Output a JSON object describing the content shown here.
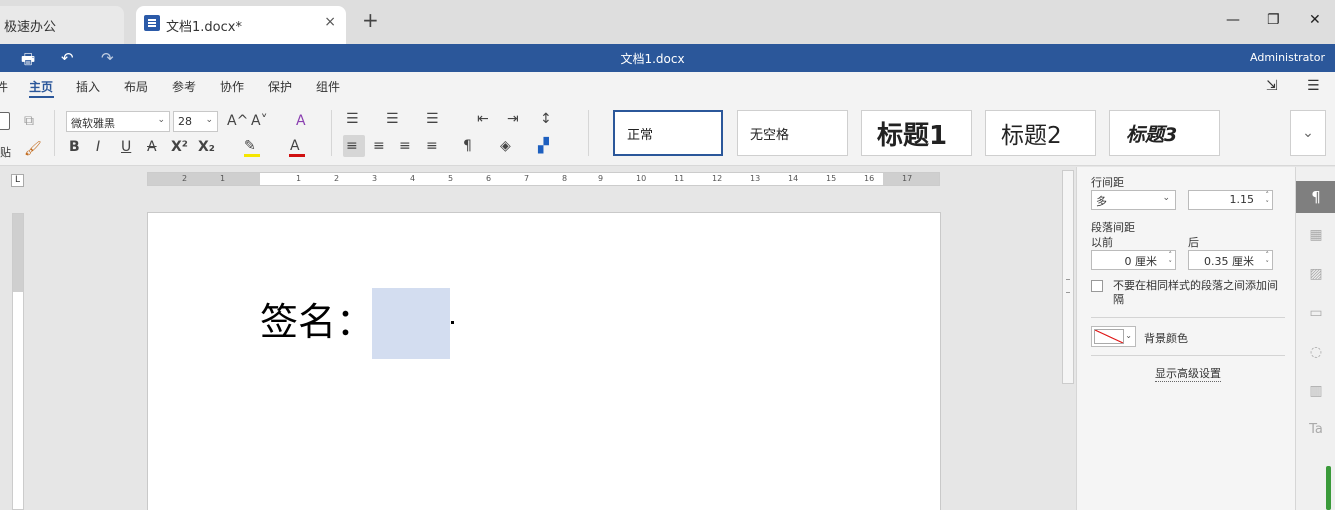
{
  "browser": {
    "inactive_tab": "极速办公",
    "active_tab": "文档1.docx*",
    "close_glyph": "×",
    "new_tab_glyph": "+",
    "minimize_glyph": "—",
    "restore_glyph": "❐",
    "close_window_glyph": "✕"
  },
  "titlebar": {
    "doc_title": "文档1.docx",
    "user": "Administrator",
    "print_icon": "🖶",
    "undo_icon": "↶",
    "redo_icon": "↷"
  },
  "menu": {
    "items": [
      {
        "label": "件"
      },
      {
        "label": "主页"
      },
      {
        "label": "插入"
      },
      {
        "label": "布局"
      },
      {
        "label": "参考"
      },
      {
        "label": "协作"
      },
      {
        "label": "保护"
      },
      {
        "label": "组件"
      }
    ],
    "open_location_icon": "⇲",
    "more_icon": "☰"
  },
  "toolbar": {
    "paste_label": "贴",
    "font_name": "微软雅黑",
    "font_size": "28",
    "caret": "⌄",
    "grow_font": "A^",
    "shrink_font": "A˅",
    "clear_format": "A",
    "bold": "B",
    "italic": "I",
    "underline": "U",
    "strikethrough": "A",
    "superscript": "X²",
    "subscript": "X₂",
    "highlight_color": "#f5e600",
    "font_color": "#d01010",
    "pilcrow": "¶",
    "styles": [
      {
        "label": "正常"
      },
      {
        "label": "无空格"
      },
      {
        "label": "标题1"
      },
      {
        "label": "标题2"
      },
      {
        "label": "标题3"
      }
    ],
    "expand_glyph": "⌄"
  },
  "document": {
    "signature_text": "签名："
  },
  "right_panel": {
    "line_spacing_label": "行间距",
    "line_spacing_mode": "多",
    "line_spacing_value": "1.15",
    "paragraph_spacing_label": "段落间距",
    "before_label": "以前",
    "after_label": "后",
    "before_value": "0 厘米",
    "after_value": "0.35 厘米",
    "no_space_same_style": "不要在相同样式的段落之间添加间隔",
    "background_color_label": "背景颜色",
    "advanced_settings": "显示高级设置"
  },
  "ruler_numbers": [
    "2",
    "1",
    "1",
    "2",
    "3",
    "4",
    "5",
    "6",
    "7",
    "8",
    "9",
    "10",
    "11",
    "12",
    "13",
    "14",
    "15",
    "16",
    "17"
  ],
  "icons": {
    "paragraph_settings": "¶",
    "table_settings": "▦",
    "image_settings": "▨",
    "header_footer": "▭",
    "shape_settings": "◌",
    "chart_settings": "▥",
    "text_art": "Ta"
  }
}
